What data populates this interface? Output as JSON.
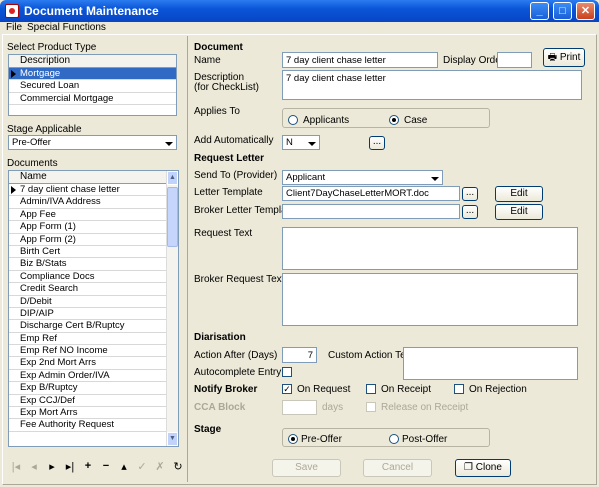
{
  "window": {
    "title": "Document Maintenance"
  },
  "menu": {
    "file": "File",
    "special": "Special Functions"
  },
  "left": {
    "product_type_label": "Select Product Type",
    "product_header": "Description",
    "products": [
      "Mortgage",
      "Secured Loan",
      "Commercial Mortgage"
    ],
    "stage_label": "Stage Applicable",
    "stage_value": "Pre-Offer",
    "documents_label": "Documents",
    "doc_header": "Name",
    "documents": [
      "7 day client chase letter",
      "Admin/IVA Address",
      "App Fee",
      "App Form (1)",
      "App Form (2)",
      "Birth Cert",
      "Biz B/Stats",
      "Compliance Docs",
      "Credit Search",
      "D/Debit",
      "DIP/AIP",
      "Discharge Cert B/Ruptcy",
      "Emp Ref",
      "Emp Ref NO Income",
      "Exp 2nd Mort Arrs",
      "Exp Admin Order/IVA",
      "Exp B/Ruptcy",
      "Exp CCJ/Def",
      "Exp Mort Arrs",
      "Fee Authority Request"
    ]
  },
  "form": {
    "document_heading": "Document",
    "name_label": "Name",
    "name_value": "7 day client chase letter",
    "display_order_label": "Display Order",
    "display_order_value": "",
    "print_label": "Print",
    "description_label": "Description",
    "description_sub": "(for CheckList)",
    "description_value": "7 day client chase letter",
    "applies_to_label": "Applies To",
    "applicants_label": "Applicants",
    "case_label": "Case",
    "add_auto_label": "Add Automatically",
    "add_auto_value": "N",
    "ellipsis": "...",
    "request_letter_heading": "Request Letter",
    "send_to_label": "Send To (Provider)",
    "send_to_value": "Applicant",
    "letter_template_label": "Letter Template",
    "letter_template_value": "Client7DayChaseLetterMORT.doc",
    "broker_template_label": "Broker Letter Template",
    "broker_template_value": "",
    "edit_label": "Edit",
    "request_text_label": "Request Text",
    "broker_request_label": "Broker Request Text",
    "diarisation_heading": "Diarisation",
    "action_after_label": "Action After (Days)",
    "action_after_value": "7",
    "custom_action_label": "Custom Action Text",
    "autocomplete_label": "Autocomplete Entry",
    "notify_broker_heading": "Notify Broker",
    "on_request_label": "On Request",
    "on_receipt_label": "On Receipt",
    "on_rejection_label": "On Rejection",
    "cca_block_label": "CCA Block",
    "days_label": "days",
    "release_label": "Release on Receipt",
    "stage_heading": "Stage",
    "pre_offer_label": "Pre-Offer",
    "post_offer_label": "Post-Offer",
    "save_label": "Save",
    "cancel_label": "Cancel",
    "clone_label": "Clone"
  },
  "nav_icons": [
    "first-icon",
    "prev-icon",
    "next-icon",
    "last-icon",
    "add-icon",
    "delete-icon",
    "edit-icon",
    "post-icon",
    "cancel-edit-icon",
    "refresh-icon"
  ]
}
